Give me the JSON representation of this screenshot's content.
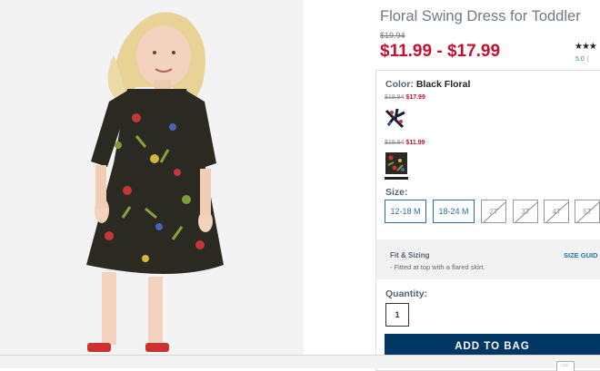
{
  "product": {
    "title": "Floral Swing Dress for Toddler",
    "original_price": "$19.94",
    "price_range": "$11.99 - $17.99",
    "stars": "★★★",
    "rating_value": "5.0",
    "rating_suffix": "("
  },
  "color": {
    "label": "Color:",
    "selected_name": "Black Floral",
    "swatches": [
      {
        "name": "navy-floral",
        "strike_price": "$19.94",
        "sale_price": "$17.99",
        "selected": false
      },
      {
        "name": "black-floral",
        "strike_price": "$19.94",
        "sale_price": "$11.99",
        "selected": true
      }
    ]
  },
  "size": {
    "label": "Size:",
    "options": [
      {
        "label": "12-18 M",
        "available": true
      },
      {
        "label": "18-24 M",
        "available": true
      },
      {
        "label": "2T",
        "available": false
      },
      {
        "label": "3T",
        "available": false
      },
      {
        "label": "4T",
        "available": false
      },
      {
        "label": "5T",
        "available": false
      }
    ]
  },
  "fit": {
    "title": "Fit & Sizing",
    "description": "- Fitted at top with a flared skirt.",
    "size_guide_label": "SIZE GUID"
  },
  "quantity": {
    "label": "Quantity:",
    "value": "1"
  },
  "actions": {
    "add_to_bag_label": "ADD TO BAG"
  },
  "colors": {
    "price_red": "#c8102e",
    "link_blue": "#2a6f9d",
    "button_navy": "#003764"
  }
}
